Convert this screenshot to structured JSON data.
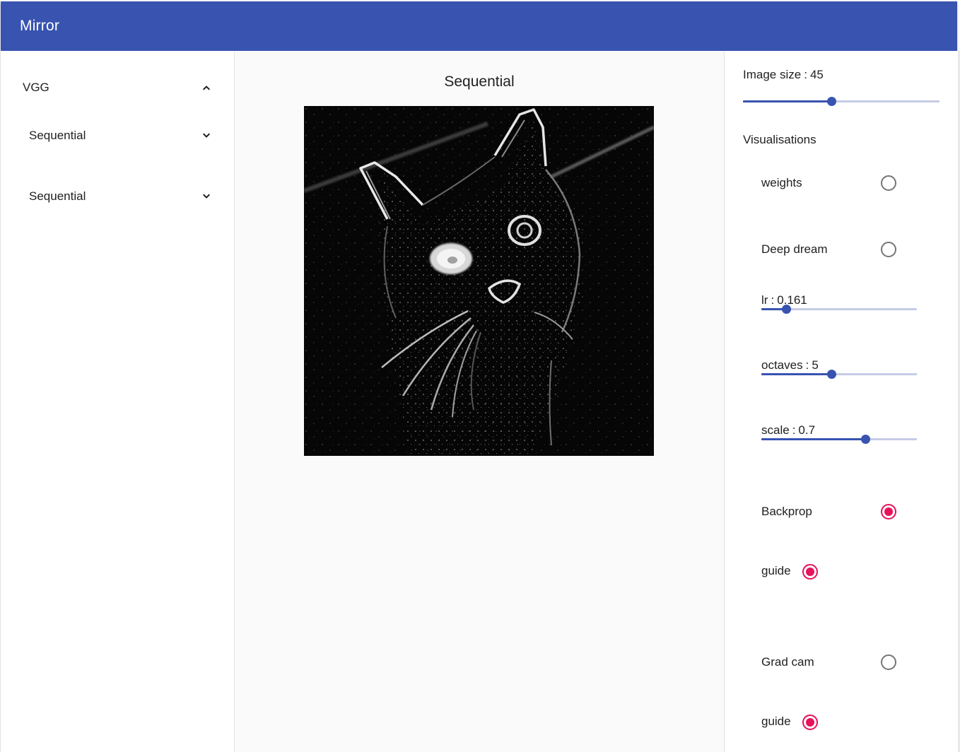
{
  "app": {
    "title": "Mirror"
  },
  "tree": {
    "root": {
      "label": "VGG",
      "expanded": true,
      "icon": "chevron-up-icon"
    },
    "children": [
      {
        "label": "Sequential",
        "expanded": false,
        "icon": "chevron-down-icon"
      },
      {
        "label": "Sequential",
        "expanded": false,
        "icon": "chevron-down-icon"
      }
    ]
  },
  "main": {
    "title": "Sequential",
    "image_alt": "cat-saliency-visualisation"
  },
  "settings": {
    "image_size": {
      "label": "Image size",
      "value": "45",
      "fraction": 0.45
    },
    "visualisations_label": "Visualisations",
    "weights": {
      "label": "weights",
      "selected": false
    },
    "deep_dream": {
      "label": "Deep dream",
      "selected": false,
      "lr": {
        "label": "lr",
        "value": "0.161",
        "fraction": 0.161
      },
      "octaves": {
        "label": "octaves",
        "value": "5",
        "fraction": 0.45
      },
      "scale": {
        "label": "scale",
        "value": "0.7",
        "fraction": 0.67
      }
    },
    "backprop": {
      "label": "Backprop",
      "selected": true,
      "guide_label": "guide",
      "guide_selected": true
    },
    "grad_cam": {
      "label": "Grad cam",
      "selected": false,
      "guide_label": "guide",
      "guide_selected": true
    }
  },
  "colors": {
    "primary": "#3853b0",
    "accent": "#e8115b",
    "rail": "#c5cbe6"
  }
}
